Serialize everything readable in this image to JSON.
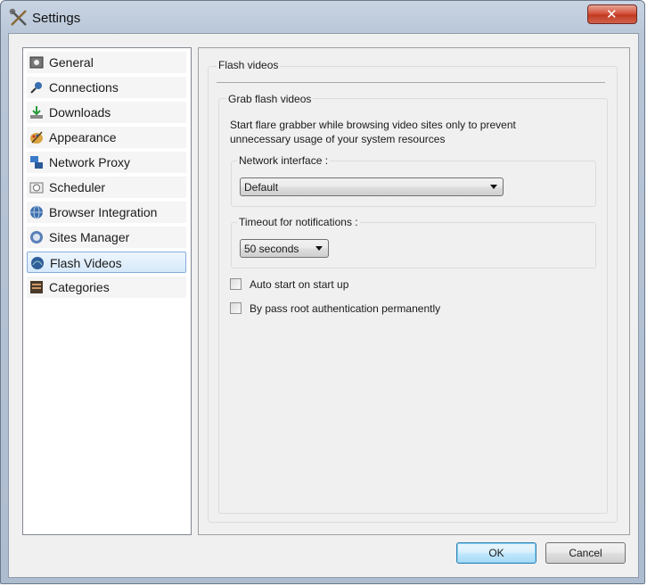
{
  "window": {
    "title": "Settings"
  },
  "sidebar": {
    "items": [
      {
        "label": "General",
        "icon": "general-icon",
        "selected": false
      },
      {
        "label": "Connections",
        "icon": "connections-icon",
        "selected": false
      },
      {
        "label": "Downloads",
        "icon": "downloads-icon",
        "selected": false
      },
      {
        "label": "Appearance",
        "icon": "appearance-icon",
        "selected": false
      },
      {
        "label": "Network Proxy",
        "icon": "network-proxy-icon",
        "selected": false
      },
      {
        "label": "Scheduler",
        "icon": "scheduler-icon",
        "selected": false
      },
      {
        "label": "Browser Integration",
        "icon": "browser-integration-icon",
        "selected": false
      },
      {
        "label": "Sites Manager",
        "icon": "sites-manager-icon",
        "selected": false
      },
      {
        "label": "Flash Videos",
        "icon": "flash-videos-icon",
        "selected": true
      },
      {
        "label": "Categories",
        "icon": "categories-icon",
        "selected": false
      }
    ]
  },
  "panel": {
    "title": "Flash videos",
    "grab_group": {
      "title": "Grab flash videos",
      "description": "Start flare grabber while browsing video sites only to prevent unnecessary usage of your system resources",
      "network_interface": {
        "label": "Network interface :",
        "value": "Default"
      },
      "timeout": {
        "label": "Timeout for notifications :",
        "value": "50 seconds"
      },
      "auto_start": {
        "label": "Auto start on start up",
        "checked": false
      },
      "bypass_root": {
        "label": "By pass root authentication permanently",
        "checked": false
      }
    }
  },
  "buttons": {
    "ok": "OK",
    "cancel": "Cancel"
  },
  "colors": {
    "selection_border": "#84acdd",
    "default_button_border": "#3c7fb1",
    "close_button": "#c13a22"
  }
}
